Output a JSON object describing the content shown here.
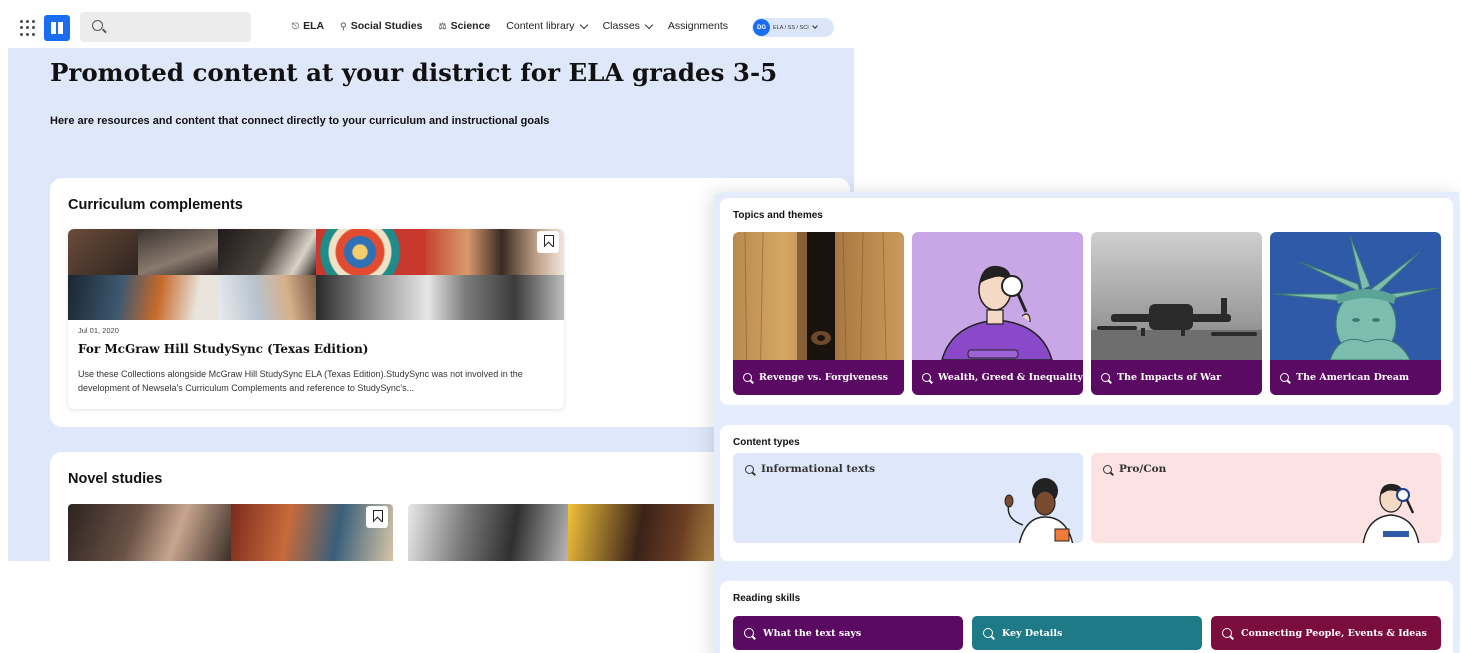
{
  "nav": {
    "links": [
      {
        "label": "ELA",
        "icon": "book-icon",
        "bold": true
      },
      {
        "label": "Social Studies",
        "icon": "pin-icon",
        "bold": true
      },
      {
        "label": "Science",
        "icon": "flask-icon",
        "bold": true
      },
      {
        "label": "Content library",
        "dropdown": true
      },
      {
        "label": "Classes",
        "dropdown": true
      },
      {
        "label": "Assignments"
      }
    ],
    "user": {
      "initials": "DG",
      "label": "ELA / SS / SCI"
    }
  },
  "hero": {
    "title": "Promoted content at your district for ELA grades 3-5",
    "subtitle": "Here are resources and content that connect directly to your curriculum and instructional goals"
  },
  "curriculum": {
    "title": "Curriculum complements",
    "card": {
      "date": "Jul 01, 2020",
      "title": "For McGraw Hill StudySync (Texas Edition)",
      "description": "Use these Collections alongside McGraw Hill StudySync ELA (Texas Edition).StudySync was not involved in the development of Newsela's Curriculum Complements and reference to StudySync's..."
    }
  },
  "novel_studies": {
    "title": "Novel studies"
  },
  "topics": {
    "title": "Topics and themes",
    "tiles": [
      {
        "label": "Revenge vs. Forgiveness",
        "image": "wood-peephole"
      },
      {
        "label": "Wealth, Greed & Inequality",
        "image": "magnifier-illustration"
      },
      {
        "label": "The Impacts of War",
        "image": "bomber-planes"
      },
      {
        "label": "The American Dream",
        "image": "statue-of-liberty"
      }
    ]
  },
  "content_types": {
    "title": "Content types",
    "items": [
      {
        "label": "Informational texts",
        "bg": "#dfe8fb"
      },
      {
        "label": "Pro/Con",
        "bg": "#fde2e4"
      }
    ]
  },
  "reading_skills": {
    "title": "Reading skills",
    "items": [
      {
        "label": "What the text says",
        "bg": "#5a0a63"
      },
      {
        "label": "Key Details",
        "bg": "#1e7a86"
      },
      {
        "label": "Connecting People, Events & Ideas",
        "bg": "#7a0d3d"
      }
    ]
  },
  "colors": {
    "brand": "#1a6cf0",
    "topic_bar": "#5a0a63",
    "page_bg": "#dfe8fb"
  }
}
